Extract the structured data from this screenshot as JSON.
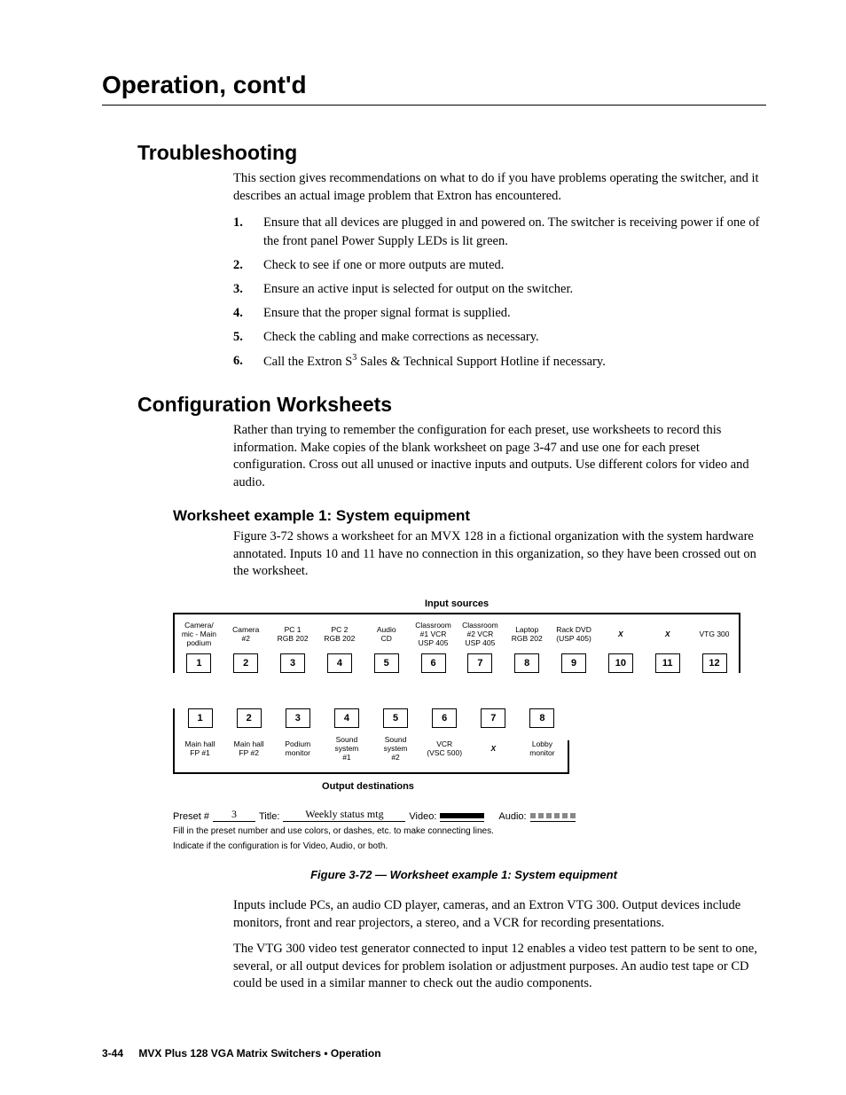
{
  "chapter_title": "Operation, cont'd",
  "sections": {
    "troubleshooting": {
      "heading": "Troubleshooting",
      "intro": "This section gives recommendations on what to do if you have problems operating the switcher, and it describes an actual image problem that Extron has encountered.",
      "steps": [
        "Ensure that all devices are plugged in and powered on.  The switcher is receiving power if one of the front panel Power Supply LEDs is lit green.",
        "Check to see if one or more outputs are muted.",
        "Ensure an active input is selected for output on the switcher.",
        "Ensure that the proper signal format is supplied.",
        "Check the cabling and make corrections as necessary.",
        "Call the Extron S³ Sales & Technical Support Hotline if necessary."
      ]
    },
    "config_ws": {
      "heading": "Configuration Worksheets",
      "intro": "Rather than trying to remember the configuration for each preset, use worksheets to record this information.  Make copies of the blank worksheet on page 3-47 and use one for each preset configuration.  Cross out all unused or inactive inputs and outputs.  Use different colors for video and audio.",
      "example1": {
        "heading": "Worksheet example 1: System equipment",
        "intro": "Figure 3-72 shows a worksheet for an MVX 128 in a fictional organization with the system hardware annotated.  Inputs 10 and 11 have no connection in this organization, so they have been crossed out on the worksheet.",
        "figure": {
          "input_title": "Input  sources",
          "inputs": [
            {
              "n": "1",
              "label": "Camera/\nmic - Main\npodium"
            },
            {
              "n": "2",
              "label": "Camera\n#2"
            },
            {
              "n": "3",
              "label": "PC 1\nRGB 202"
            },
            {
              "n": "4",
              "label": "PC 2\nRGB 202"
            },
            {
              "n": "5",
              "label": "Audio\nCD"
            },
            {
              "n": "6",
              "label": "Classroom\n#1 VCR\nUSP 405"
            },
            {
              "n": "7",
              "label": "Classroom\n#2 VCR\nUSP 405"
            },
            {
              "n": "8",
              "label": "Laptop\nRGB 202"
            },
            {
              "n": "9",
              "label": "Rack DVD\n(USP 405)"
            },
            {
              "n": "10",
              "label": "X",
              "cross": true
            },
            {
              "n": "11",
              "label": "X",
              "cross": true
            },
            {
              "n": "12",
              "label": "VTG 300"
            }
          ],
          "output_title": "Output destinations",
          "outputs": [
            {
              "n": "1",
              "label": "Main hall\nFP #1"
            },
            {
              "n": "2",
              "label": "Main hall\nFP #2"
            },
            {
              "n": "3",
              "label": "Podium\nmonitor"
            },
            {
              "n": "4",
              "label": "Sound\nsystem\n#1"
            },
            {
              "n": "5",
              "label": "Sound\nsystem\n#2"
            },
            {
              "n": "6",
              "label": "VCR\n(VSC 500)"
            },
            {
              "n": "7",
              "label": "X",
              "cross": true
            },
            {
              "n": "8",
              "label": "Lobby\nmonitor"
            }
          ],
          "form": {
            "preset_label": "Preset #",
            "preset_value": "3",
            "title_label": "Title:",
            "title_value": "Weekly status mtg",
            "video_label": "Video:",
            "audio_label": "Audio:"
          },
          "note1": "Fill in the preset number and use colors, or dashes, etc. to make connecting lines.",
          "note2": "Indicate if the configuration is for Video, Audio, or both.",
          "caption": "Figure 3-72 — Worksheet example 1: System equipment"
        },
        "after1": "Inputs include PCs, an audio CD player, cameras, and an Extron VTG 300.  Output devices include monitors, front and rear projectors, a stereo, and a VCR for recording presentations.",
        "after2": "The VTG 300 video test generator connected to input 12 enables a video test pattern to be sent to one, several, or all output devices for problem isolation or adjustment purposes.  An audio test tape or CD could be used in a similar manner to check out the audio components."
      }
    }
  },
  "footer": {
    "page": "3-44",
    "title": "MVX Plus 128 VGA Matrix Switchers • Operation"
  }
}
